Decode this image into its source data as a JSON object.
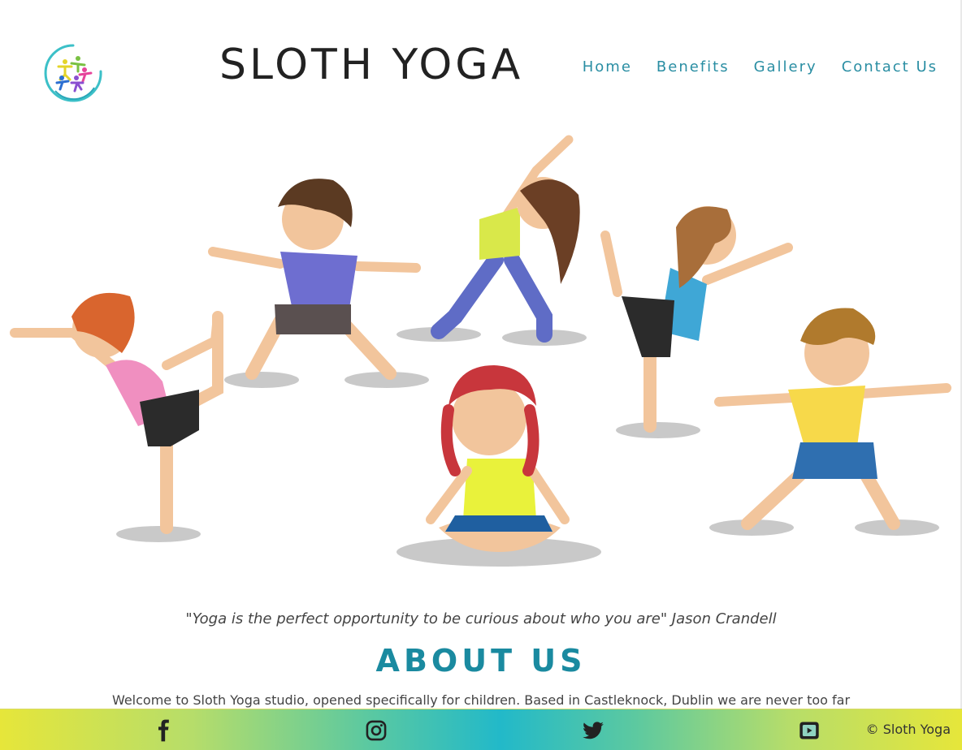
{
  "brand": {
    "title": "SLOTH YOGA"
  },
  "nav": {
    "items": [
      {
        "label": "Home"
      },
      {
        "label": "Benefits"
      },
      {
        "label": "Gallery"
      },
      {
        "label": "Contact Us"
      }
    ]
  },
  "hero": {
    "image_desc_icon": "kids-yoga-illustration"
  },
  "quote": "\"Yoga is the perfect opportunity to be curious about who you are\" Jason Crandell",
  "about": {
    "title": "ABOUT US",
    "text": "Welcome to Sloth Yoga studio, opened specifically for children. Based in Castleknock, Dublin we are never too far"
  },
  "footer": {
    "icons": [
      "facebook-icon",
      "instagram-icon",
      "twitter-icon",
      "youtube-icon"
    ],
    "copyright": "© Sloth Yoga"
  },
  "colors": {
    "accent": "#2a8ea3",
    "heading": "#1a8aa0",
    "footer_teal": "#22b9c9",
    "footer_yellow": "#e6e63a"
  }
}
